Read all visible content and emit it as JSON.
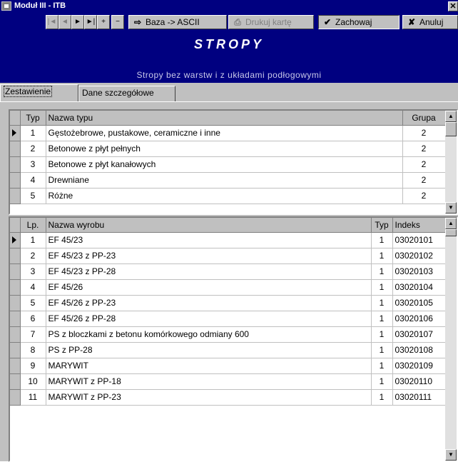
{
  "window": {
    "title": "Moduł III - ITB",
    "close_icon": "✕"
  },
  "toolbar": {
    "nav": [
      {
        "name": "nav-first-button",
        "icon": "first-record-icon",
        "glyph": "|◄",
        "enabled": false
      },
      {
        "name": "nav-prev-button",
        "icon": "prev-record-icon",
        "glyph": "◄",
        "enabled": false
      },
      {
        "name": "nav-next-button",
        "icon": "next-record-icon",
        "glyph": "►",
        "enabled": true
      },
      {
        "name": "nav-last-button",
        "icon": "last-record-icon",
        "glyph": "►|",
        "enabled": true
      },
      {
        "name": "nav-add-button",
        "icon": "plus-icon",
        "glyph": "+",
        "enabled": true
      },
      {
        "name": "nav-delete-button",
        "icon": "minus-icon",
        "glyph": "−",
        "enabled": true
      }
    ],
    "export_label": "Baza -> ASCII",
    "export_glyph": "⇨",
    "print_label": "Drukuj kartę",
    "print_glyph": "⎙",
    "save_label": "Zachowaj",
    "save_glyph": "✔",
    "cancel_label": "Anuluj",
    "cancel_glyph": "✘"
  },
  "header": {
    "title": "STROPY",
    "subtitle": "Stropy bez warstw i z układami podłogowymi"
  },
  "tabs": [
    {
      "label": "Zestawienie",
      "active": true
    },
    {
      "label": "Dane szczegółowe",
      "active": false
    }
  ],
  "types_table": {
    "columns": [
      "Typ",
      "Nazwa typu",
      "Grupa"
    ],
    "rows": [
      {
        "typ": "1",
        "nazwa": "Gęstożebrowe, pustakowe, ceramiczne i inne",
        "grupa": "2",
        "selected": true
      },
      {
        "typ": "2",
        "nazwa": "Betonowe z płyt pełnych",
        "grupa": "2",
        "selected": false
      },
      {
        "typ": "3",
        "nazwa": "Betonowe z płyt kanałowych",
        "grupa": "2",
        "selected": false
      },
      {
        "typ": "4",
        "nazwa": "Drewniane",
        "grupa": "2",
        "selected": false
      },
      {
        "typ": "5",
        "nazwa": "Różne",
        "grupa": "2",
        "selected": false
      }
    ]
  },
  "products_table": {
    "columns": [
      "Lp.",
      "Nazwa wyrobu",
      "Typ",
      "Indeks"
    ],
    "rows": [
      {
        "lp": "1",
        "nazwa": "EF 45/23",
        "typ": "1",
        "indeks": "03020101",
        "selected": true
      },
      {
        "lp": "2",
        "nazwa": "EF 45/23 z PP-23",
        "typ": "1",
        "indeks": "03020102",
        "selected": false
      },
      {
        "lp": "3",
        "nazwa": "EF 45/23 z PP-28",
        "typ": "1",
        "indeks": "03020103",
        "selected": false
      },
      {
        "lp": "4",
        "nazwa": "EF 45/26",
        "typ": "1",
        "indeks": "03020104",
        "selected": false
      },
      {
        "lp": "5",
        "nazwa": "EF 45/26 z PP-23",
        "typ": "1",
        "indeks": "03020105",
        "selected": false
      },
      {
        "lp": "6",
        "nazwa": "EF 45/26 z PP-28",
        "typ": "1",
        "indeks": "03020106",
        "selected": false
      },
      {
        "lp": "7",
        "nazwa": "PS z bloczkami z betonu komórkowego odmiany 600",
        "typ": "1",
        "indeks": "03020107",
        "selected": false
      },
      {
        "lp": "8",
        "nazwa": "PS z PP-28",
        "typ": "1",
        "indeks": "03020108",
        "selected": false
      },
      {
        "lp": "9",
        "nazwa": "MARYWIT",
        "typ": "1",
        "indeks": "03020109",
        "selected": false
      },
      {
        "lp": "10",
        "nazwa": "MARYWIT z PP-18",
        "typ": "1",
        "indeks": "03020110",
        "selected": false
      },
      {
        "lp": "11",
        "nazwa": "MARYWIT z PP-23",
        "typ": "1",
        "indeks": "03020111",
        "selected": false
      }
    ]
  },
  "scroll": {
    "up_glyph": "▲",
    "down_glyph": "▼"
  }
}
